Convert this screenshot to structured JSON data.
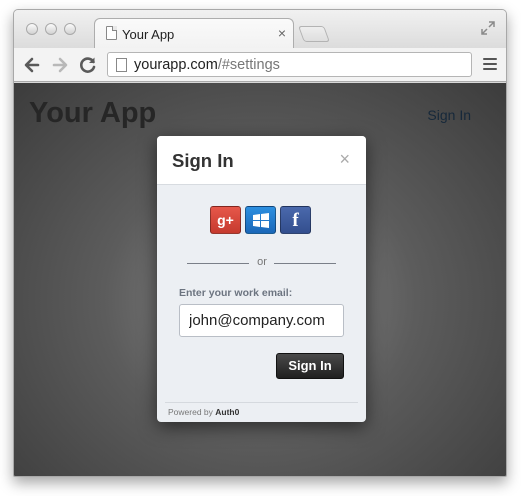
{
  "browser": {
    "tab_title": "Your App",
    "tab_close": "×",
    "url_domain": "yourapp.com",
    "url_path": "/#settings"
  },
  "app": {
    "brand": "Your App",
    "header_signin": "Sign In"
  },
  "modal": {
    "title": "Sign In",
    "close": "×",
    "social": [
      {
        "name": "google",
        "label": "g+",
        "color": "#dd4b39"
      },
      {
        "name": "windows",
        "label": "",
        "color": "#1e7ad0"
      },
      {
        "name": "facebook",
        "label": "f",
        "color": "#3b5998"
      }
    ],
    "divider": "or",
    "email_label": "Enter your work email:",
    "email_value": "john@company.com",
    "submit": "Sign In",
    "powered_prefix": "Powered by",
    "powered_brand": "Auth0"
  },
  "colors": {
    "accent": "#16283a",
    "submit_bg": "#2b2b2b"
  }
}
